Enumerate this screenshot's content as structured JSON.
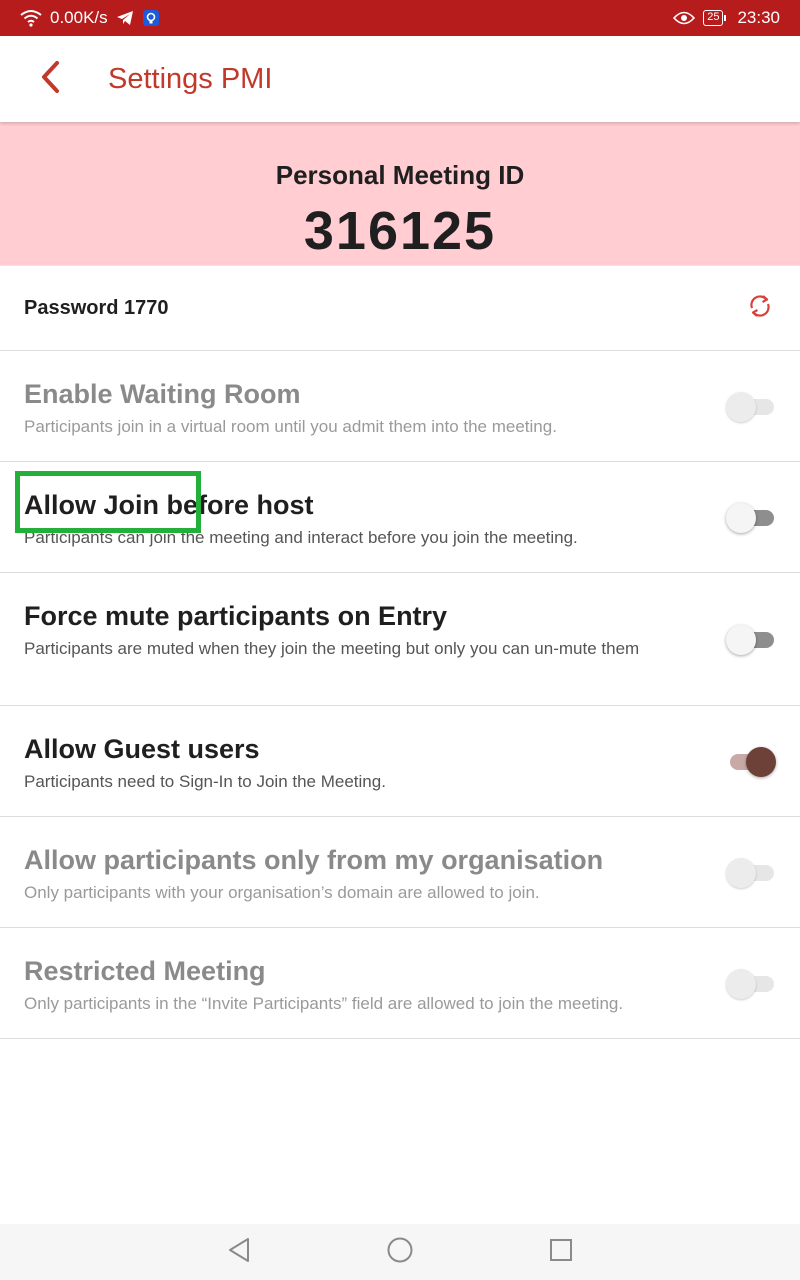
{
  "status_bar": {
    "network_speed": "0.00K/s",
    "battery_level": "25",
    "time": "23:30",
    "icons": [
      "wifi-icon",
      "telegram-icon",
      "vpn-shield-icon",
      "eye-icon",
      "battery-icon"
    ]
  },
  "app_bar": {
    "title": "Settings PMI",
    "back_icon": "chevron-left-icon",
    "accent_color": "#c0392b"
  },
  "pmi": {
    "label": "Personal Meeting ID",
    "number": "316125",
    "panel_color": "#ffcdd2"
  },
  "password": {
    "text": "Password 1770",
    "refresh_icon": "refresh-icon"
  },
  "settings": [
    {
      "title": "Enable Waiting Room",
      "description": "Participants join in a virtual room until you admit them into the meeting.",
      "enabled": false,
      "toggled": false
    },
    {
      "title": "Allow Join before host",
      "description": "Participants can join the meeting and interact before you join the meeting.",
      "enabled": true,
      "toggled": false
    },
    {
      "title": "Force mute participants on Entry",
      "description": "Participants are muted when they join the meeting but only you can un-mute them",
      "enabled": true,
      "toggled": false
    },
    {
      "title": "Allow Guest users",
      "description": "Participants need to Sign-In to Join the Meeting.",
      "enabled": true,
      "toggled": true
    },
    {
      "title": "Allow participants only from my organisation",
      "description": "Only participants with your organisation’s domain are allowed to join.",
      "enabled": false,
      "toggled": false
    },
    {
      "title": "Restricted Meeting",
      "description": "Only participants in the “Invite Participants” field are allowed to join the meeting.",
      "enabled": false,
      "toggled": false
    }
  ],
  "highlight": {
    "color": "#22b03a",
    "target": "Allow Join before host"
  },
  "nav_bar": {
    "icons": [
      "back-triangle-icon",
      "home-circle-icon",
      "recents-square-icon"
    ]
  }
}
